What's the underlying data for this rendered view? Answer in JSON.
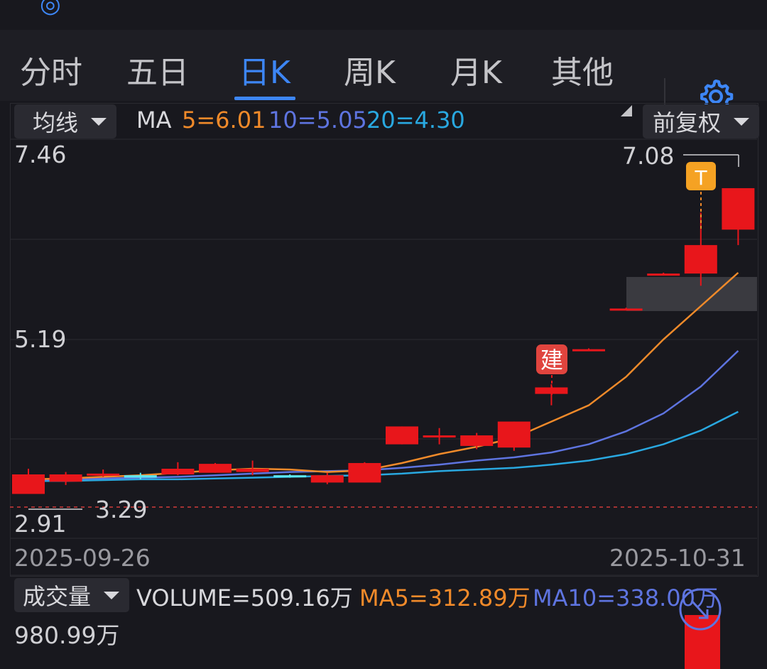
{
  "tabs": [
    {
      "label": "分时",
      "active": false
    },
    {
      "label": "五日",
      "active": false
    },
    {
      "label": "日K",
      "active": true
    },
    {
      "label": "周K",
      "active": false
    },
    {
      "label": "月K",
      "active": false
    },
    {
      "label": "其他",
      "active": false
    }
  ],
  "settings_icon": "gear-icon",
  "indicator": {
    "selector": "均线",
    "ma_label": "MA",
    "ma5": "5=6.01",
    "ma10": "10=5.05",
    "ma20": "20=4.30"
  },
  "adjust_selector": "前复权",
  "price_axis": {
    "high": "7.46",
    "mid": "5.19",
    "low": "2.91"
  },
  "annotations": {
    "max_price": "7.08",
    "min_price": "3.29",
    "marker_t": "T",
    "marker_jian": "建"
  },
  "dates": {
    "start": "2025-09-26",
    "end": "2025-10-31"
  },
  "volume": {
    "selector": "成交量",
    "value": "VOLUME=509.16万",
    "ma5": "MA5=312.89万",
    "ma10": "MA10=338.00万",
    "max": "980.99万"
  },
  "colors": {
    "up": "#e8161b",
    "down": "#5ce8f0",
    "ma5": "#f08a2a",
    "ma10": "#5e74e0",
    "ma20": "#29a8e0",
    "accent": "#3d86f5"
  },
  "chart_data": {
    "type": "candlestick",
    "y_range": [
      2.91,
      7.46
    ],
    "series": [
      {
        "open": 3.29,
        "close": 3.53,
        "high": 3.6,
        "low": 3.29
      },
      {
        "open": 3.44,
        "close": 3.53,
        "high": 3.56,
        "low": 3.4
      },
      {
        "open": 3.52,
        "close": 3.54,
        "high": 3.59,
        "low": 3.5
      },
      {
        "open": 3.52,
        "close": 3.49,
        "high": 3.55,
        "low": 3.47
      },
      {
        "open": 3.53,
        "close": 3.6,
        "high": 3.68,
        "low": 3.52
      },
      {
        "open": 3.55,
        "close": 3.66,
        "high": 3.67,
        "low": 3.55
      },
      {
        "open": 3.56,
        "close": 3.6,
        "high": 3.7,
        "low": 3.52
      },
      {
        "open": 3.52,
        "close": 3.51,
        "high": 3.53,
        "low": 3.49
      },
      {
        "open": 3.43,
        "close": 3.52,
        "high": 3.55,
        "low": 3.41
      },
      {
        "open": 3.43,
        "close": 3.67,
        "high": 3.68,
        "low": 3.43
      },
      {
        "open": 3.9,
        "close": 4.12,
        "high": 4.12,
        "low": 3.9
      },
      {
        "open": 4.0,
        "close": 4.01,
        "high": 4.1,
        "low": 3.9
      },
      {
        "open": 3.88,
        "close": 4.01,
        "high": 4.04,
        "low": 3.84
      },
      {
        "open": 3.86,
        "close": 4.18,
        "high": 4.18,
        "low": 3.82
      },
      {
        "open": 4.52,
        "close": 4.6,
        "high": 4.64,
        "low": 4.38
      },
      {
        "open": 5.06,
        "close": 5.07,
        "high": 5.08,
        "low": 5.05
      },
      {
        "open": 5.56,
        "close": 5.57,
        "high": 5.58,
        "low": 5.56
      },
      {
        "open": 5.99,
        "close": 6.0,
        "high": 6.01,
        "low": 5.98
      },
      {
        "open": 6.0,
        "close": 6.35,
        "high": 6.75,
        "low": 5.85
      },
      {
        "open": 6.54,
        "close": 7.05,
        "high": 7.05,
        "low": 6.35
      }
    ],
    "ma5": [
      3.47,
      3.48,
      3.5,
      3.52,
      3.55,
      3.58,
      3.6,
      3.59,
      3.56,
      3.58,
      3.67,
      3.78,
      3.87,
      3.98,
      4.18,
      4.38,
      4.73,
      5.19,
      5.6,
      6.01
    ],
    "ma10": [
      3.46,
      3.47,
      3.48,
      3.49,
      3.5,
      3.52,
      3.54,
      3.56,
      3.57,
      3.58,
      3.61,
      3.65,
      3.7,
      3.74,
      3.8,
      3.9,
      4.06,
      4.28,
      4.61,
      5.05
    ],
    "ma20": [
      3.45,
      3.45,
      3.46,
      3.47,
      3.47,
      3.48,
      3.49,
      3.5,
      3.51,
      3.52,
      3.54,
      3.57,
      3.59,
      3.61,
      3.65,
      3.7,
      3.78,
      3.9,
      4.07,
      4.3
    ],
    "volume_last": 509.16,
    "volume_ma5": 312.89,
    "volume_ma10": 338.0,
    "volume_max": 980.99
  }
}
